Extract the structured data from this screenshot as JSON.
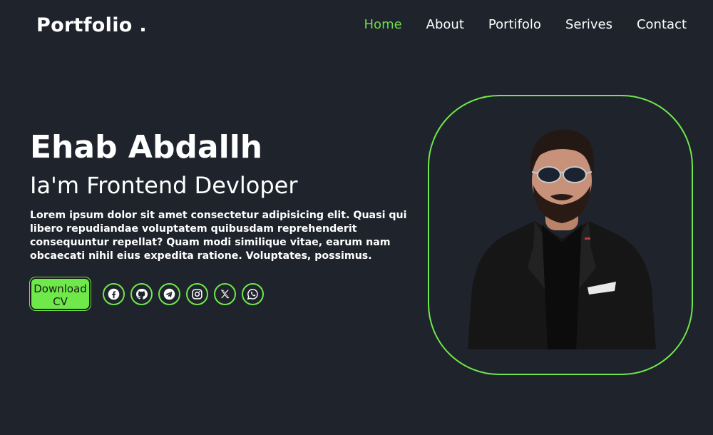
{
  "header": {
    "logo": "Portfolio .",
    "nav": [
      {
        "label": "Home",
        "active": true
      },
      {
        "label": "About",
        "active": false
      },
      {
        "label": "Portifolo",
        "active": false
      },
      {
        "label": "Serives",
        "active": false
      },
      {
        "label": "Contact",
        "active": false
      }
    ]
  },
  "hero": {
    "name": "Ehab Abdallh",
    "role": "Ia'm Frontend Devloper",
    "bio": "Lorem ipsum dolor sit amet consectetur adipisicing elit. Quasi qui libero repudiandae voluptatem quibusdam reprehenderit consequuntur repellat? Quam modi similique vitae, earum nam obcaecati nihil eius expedita ratione. Voluptates, possimus.",
    "cv_line1": "Download",
    "cv_line2": "CV"
  },
  "socials": [
    {
      "icon": "facebook-icon"
    },
    {
      "icon": "github-icon"
    },
    {
      "icon": "telegram-icon"
    },
    {
      "icon": "instagram-icon"
    },
    {
      "icon": "x-icon"
    },
    {
      "icon": "whatsapp-icon"
    }
  ],
  "colors": {
    "background": "#1f232c",
    "accent": "#6fe84a",
    "active_nav": "#6fdc4c",
    "text": "#ffffff"
  }
}
